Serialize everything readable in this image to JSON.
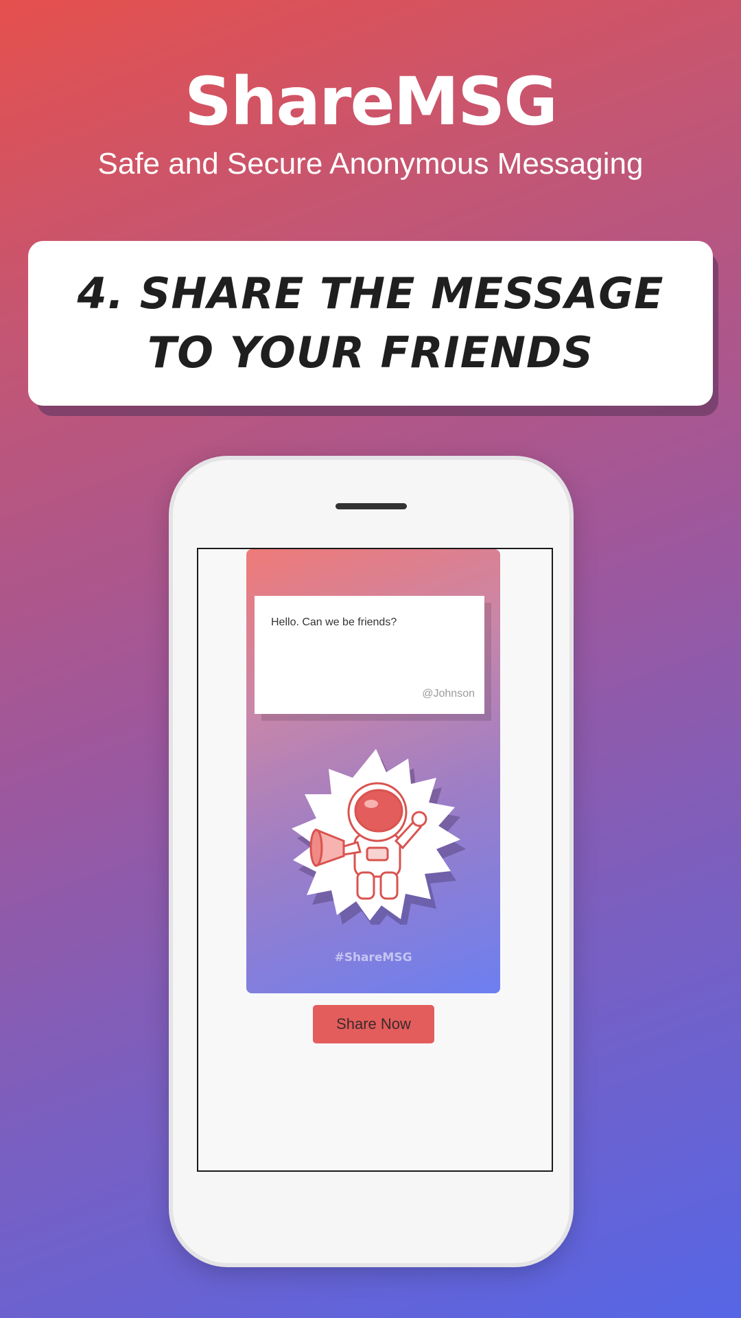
{
  "header": {
    "app_title": "ShareMSG",
    "tagline": "Safe and Secure Anonymous Messaging"
  },
  "step": {
    "text": "4. Share the message to your friends"
  },
  "phone_screen": {
    "message_card": {
      "message": "Hello. Can we be friends?",
      "author": "@Johnson",
      "hashtag": "#ShareMSG",
      "illustration": "astronaut-megaphone-icon"
    },
    "share_button_label": "Share Now"
  },
  "colors": {
    "accent": "#e35d5c",
    "gradient_start": "#e5504d",
    "gradient_end": "#5666e6"
  }
}
